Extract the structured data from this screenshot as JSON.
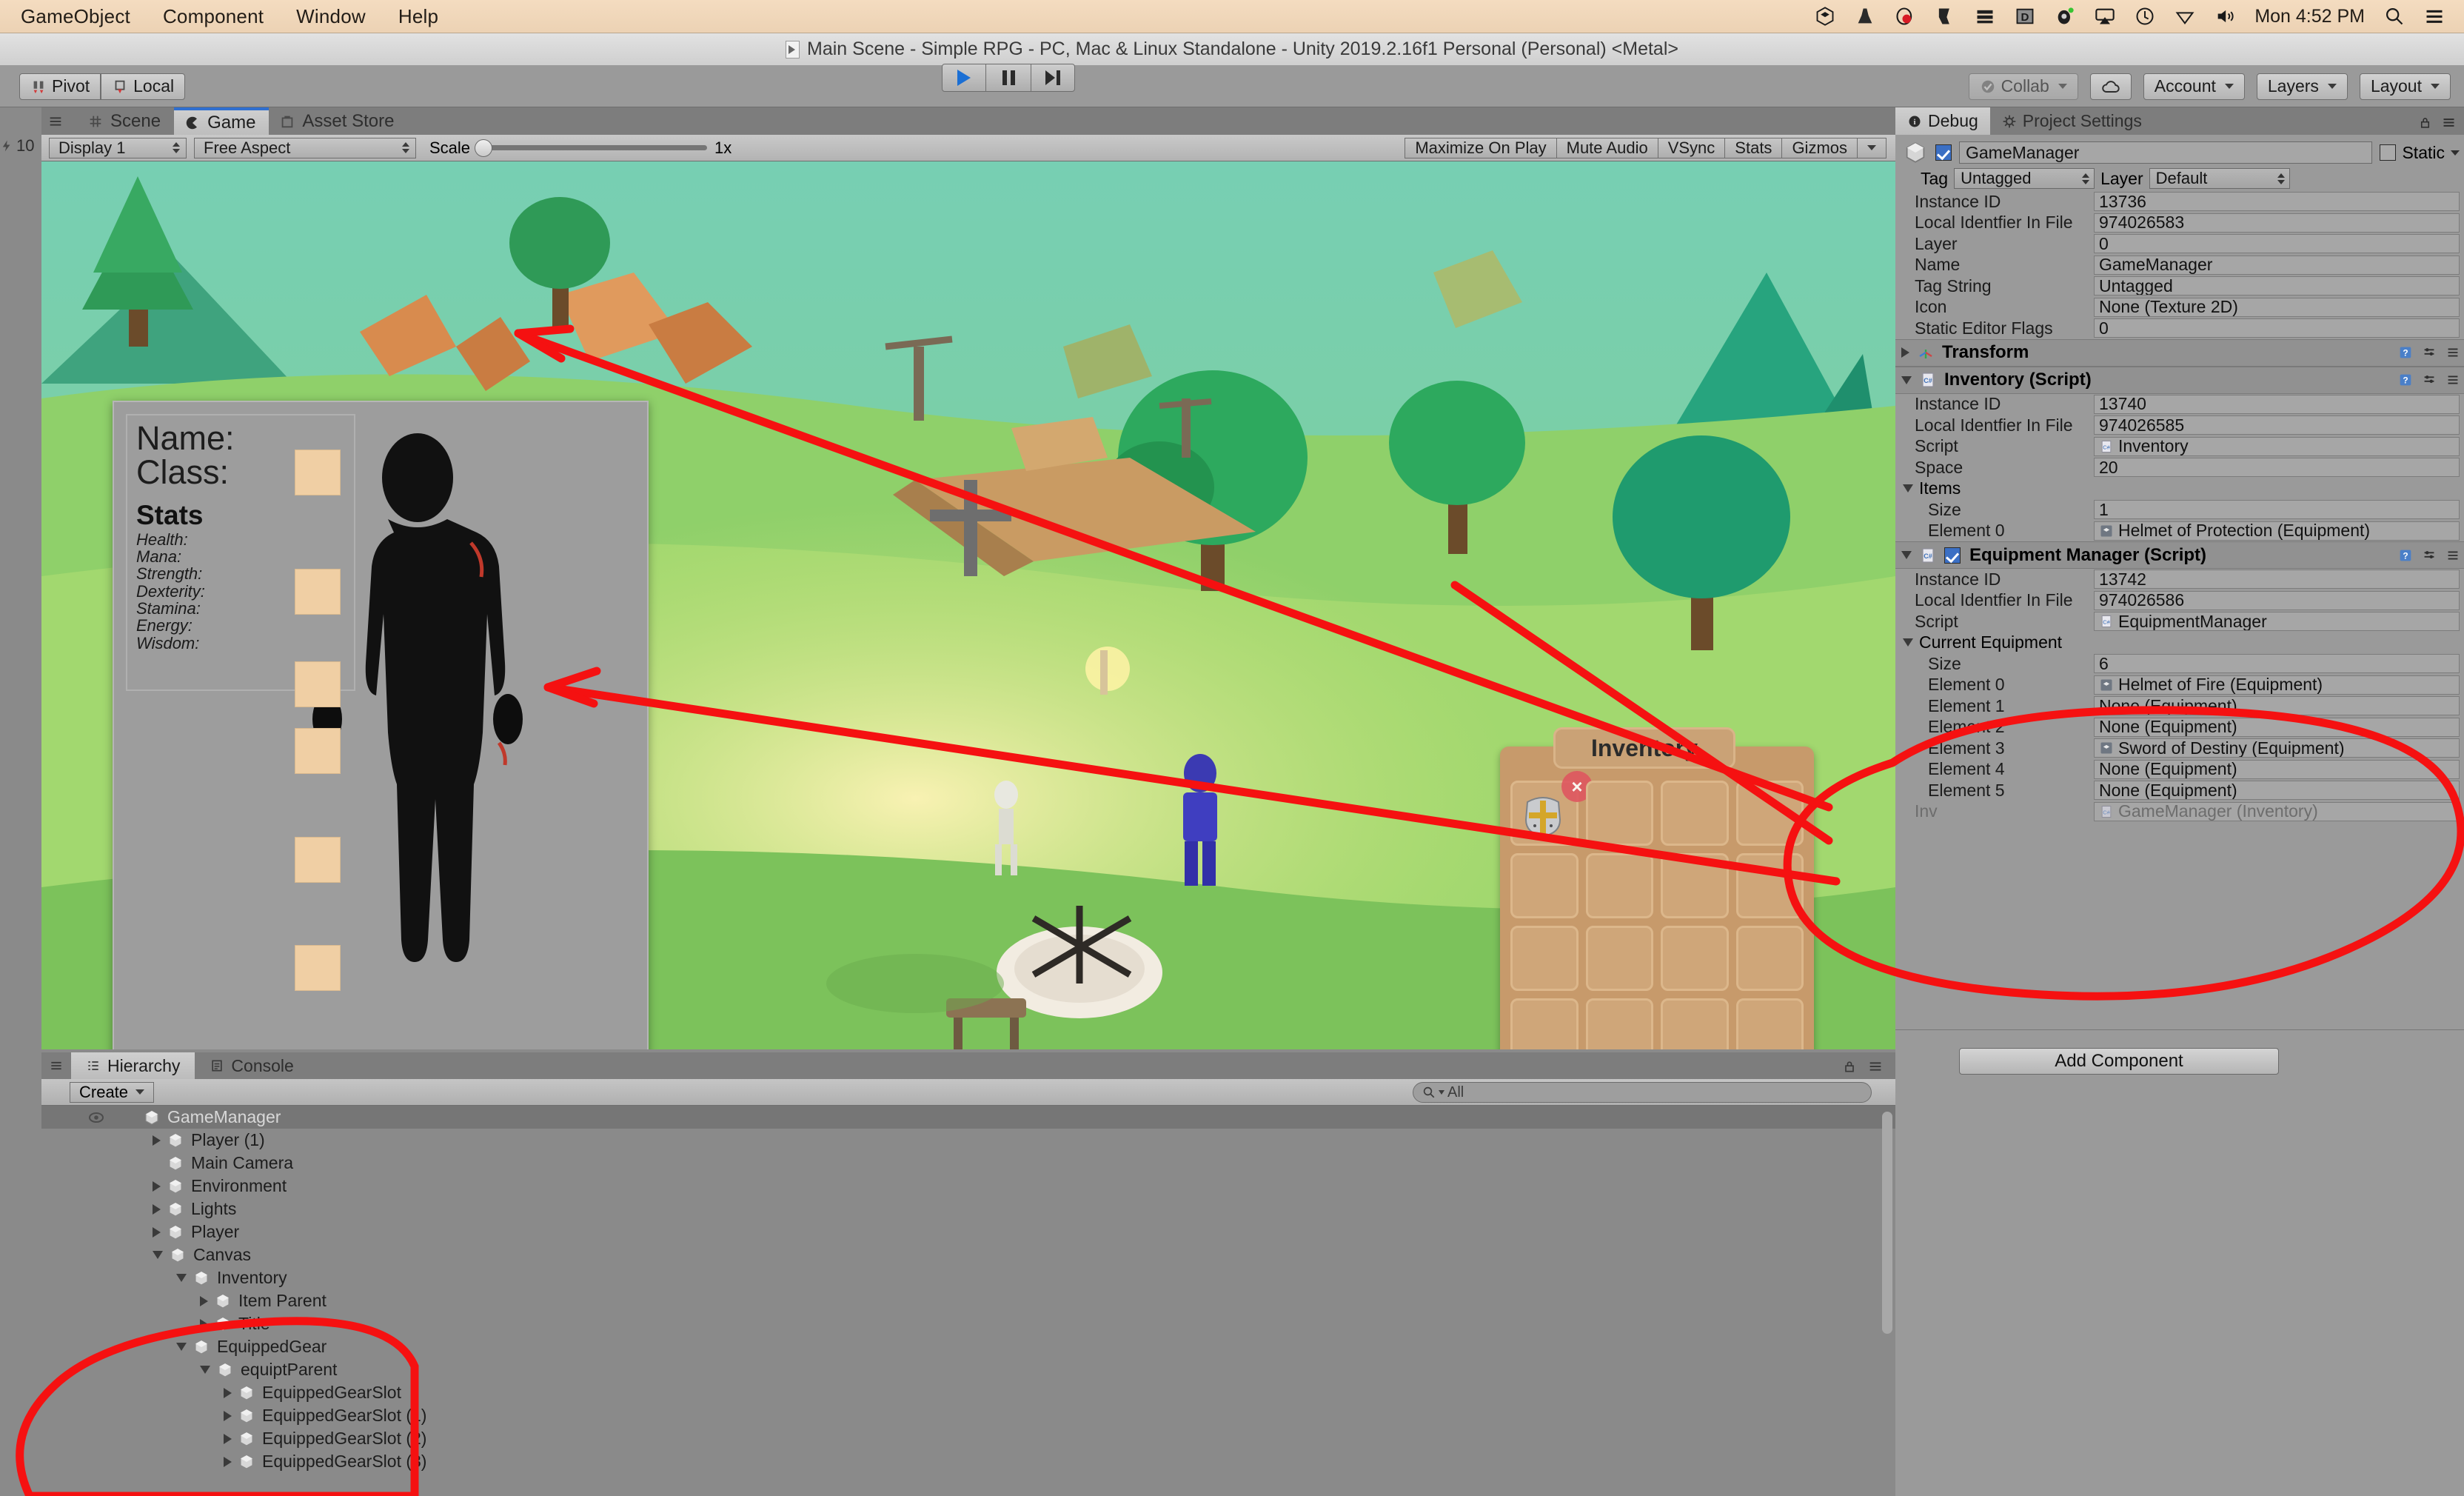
{
  "macbar": {
    "menus": [
      "GameObject",
      "Component",
      "Window",
      "Help"
    ],
    "tray_icons": [
      "unity-icon",
      "vlc-icon",
      "opera-icon",
      "anaconda-icon",
      "stack-icon",
      "dropbox-icon",
      "unity-hub-icon",
      "airplay-icon",
      "time-machine-icon",
      "wifi-icon",
      "volume-icon"
    ],
    "clock": "Mon 4:52 PM",
    "search_icon": "search-icon",
    "control_center_icon": "control-center-icon"
  },
  "titlebar": {
    "text": "Main Scene - Simple RPG - PC, Mac & Linux Standalone - Unity 2019.2.16f1 Personal (Personal) <Metal>",
    "doc_icon": "unity-document-icon"
  },
  "toolbar": {
    "pivot_label": "Pivot",
    "local_label": "Local",
    "pivot_icon": "pivot-icon",
    "local_icon": "local-icon",
    "play_icon": "play-icon",
    "pause_icon": "pause-icon",
    "step_icon": "step-icon",
    "collab_label": "Collab",
    "collab_icon": "collab-check-icon",
    "cloud_icon": "cloud-icon",
    "account_label": "Account",
    "layers_label": "Layers",
    "layout_label": "Layout"
  },
  "game_panel": {
    "tabs": [
      {
        "label": "Scene",
        "icon": "scene-grid-icon",
        "active": false
      },
      {
        "label": "Game",
        "icon": "game-pacman-icon",
        "active": true
      },
      {
        "label": "Asset Store",
        "icon": "asset-store-icon",
        "active": false
      }
    ],
    "stats_counter": "10",
    "display": "Display 1",
    "aspect": "Free Aspect",
    "scale_label": "Scale",
    "scale_value": "1x",
    "right_buttons": [
      "Maximize On Play",
      "Mute Audio",
      "VSync",
      "Stats",
      "Gizmos"
    ],
    "gizmos_caret": "chevron-down-icon"
  },
  "character_panel": {
    "name_label": "Name:",
    "class_label": "Class:",
    "stats_heading": "Stats",
    "stats": [
      "Health:",
      "Mana:",
      "Strength:",
      "Dexterity:",
      "Stamina:",
      "Energy:",
      "Wisdom:"
    ]
  },
  "inventory_panel": {
    "title": "Inventory",
    "delete_badge": "×",
    "item_icon": "knight-helmet-icon",
    "rows": 5,
    "cols": 4
  },
  "hierarchy": {
    "tabs": [
      {
        "label": "Hierarchy",
        "icon": "hierarchy-list-icon",
        "active": true
      },
      {
        "label": "Console",
        "icon": "console-icon",
        "active": false
      }
    ],
    "create_label": "Create",
    "create_caret": "chevron-down-icon",
    "search_placeholder": "All",
    "search_icon": "search-icon",
    "lock_icon": "lock-icon",
    "menu_icon": "panel-menu-icon",
    "items": [
      {
        "label": "GameManager",
        "depth": 0,
        "arrow": "none",
        "selected": true,
        "eye": true
      },
      {
        "label": "Player (1)",
        "depth": 1,
        "arrow": "closed",
        "selected": false
      },
      {
        "label": "Main Camera",
        "depth": 1,
        "arrow": "none",
        "selected": false
      },
      {
        "label": "Environment",
        "depth": 1,
        "arrow": "closed",
        "selected": false
      },
      {
        "label": "Lights",
        "depth": 1,
        "arrow": "closed",
        "selected": false
      },
      {
        "label": "Player",
        "depth": 1,
        "arrow": "closed",
        "selected": false
      },
      {
        "label": "Canvas",
        "depth": 1,
        "arrow": "open",
        "selected": false
      },
      {
        "label": "Inventory",
        "depth": 2,
        "arrow": "open",
        "selected": false
      },
      {
        "label": "Item Parent",
        "depth": 3,
        "arrow": "closed",
        "selected": false
      },
      {
        "label": "Title",
        "depth": 3,
        "arrow": "closed",
        "selected": false
      },
      {
        "label": "EquippedGear",
        "depth": 2,
        "arrow": "open",
        "selected": false
      },
      {
        "label": "equiptParent",
        "depth": 3,
        "arrow": "open",
        "selected": false
      },
      {
        "label": "EquippedGearSlot",
        "depth": 4,
        "arrow": "closed",
        "selected": false
      },
      {
        "label": "EquippedGearSlot (1)",
        "depth": 4,
        "arrow": "closed",
        "selected": false
      },
      {
        "label": "EquippedGearSlot (2)",
        "depth": 4,
        "arrow": "closed",
        "selected": false
      },
      {
        "label": "EquippedGearSlot (3)",
        "depth": 4,
        "arrow": "closed",
        "selected": false
      }
    ]
  },
  "inspector": {
    "tabs": [
      {
        "label": "Debug",
        "icon": "info-icon",
        "active": true
      },
      {
        "label": "Project Settings",
        "icon": "gear-icon",
        "active": false
      }
    ],
    "lock_icon": "lock-icon",
    "menu_icon": "panel-menu-icon",
    "gameobject_name": "GameManager",
    "gameobject_enabled": true,
    "static_label": "Static",
    "static_checked": false,
    "static_caret": "chevron-down-icon",
    "tag_label": "Tag",
    "tag_value": "Untagged",
    "layer_label": "Layer",
    "layer_value": "Default",
    "gameobject_props": [
      {
        "label": "Instance ID",
        "value": "13736"
      },
      {
        "label": "Local Identfier In File",
        "value": "974026583"
      },
      {
        "label": "Layer",
        "value": "0"
      },
      {
        "label": "Name",
        "value": "GameManager"
      },
      {
        "label": "Tag String",
        "value": "Untagged"
      },
      {
        "label": "Icon",
        "value": "None (Texture 2D)"
      },
      {
        "label": "Static Editor Flags",
        "value": "0"
      }
    ],
    "transform": {
      "title": "Transform",
      "icon": "transform-axis-icon",
      "expanded": false,
      "help_icon": "help-book-icon",
      "preset_icon": "preset-sliders-icon",
      "menu_icon": "component-menu-icon"
    },
    "inventory_script": {
      "title": "Inventory (Script)",
      "icon": "csharp-script-icon",
      "expanded": true,
      "props": [
        {
          "label": "Instance ID",
          "value": "13740",
          "indent": 0
        },
        {
          "label": "Local Identfier In File",
          "value": "974026585",
          "indent": 0
        },
        {
          "label": "Script",
          "value": "Inventory",
          "indent": 0,
          "obj_icon": "csharp-script-icon"
        },
        {
          "label": "Space",
          "value": "20",
          "indent": 0
        }
      ],
      "items_group": "Items",
      "items": [
        {
          "label": "Size",
          "value": "1",
          "indent": 1
        },
        {
          "label": "Element 0",
          "value": "Helmet of Protection (Equipment)",
          "indent": 1,
          "obj_icon": "unity-asset-icon"
        }
      ]
    },
    "equipment_manager": {
      "title": "Equipment Manager (Script)",
      "icon": "csharp-script-icon",
      "enabled": true,
      "expanded": true,
      "props": [
        {
          "label": "Instance ID",
          "value": "13742",
          "indent": 0
        },
        {
          "label": "Local Identfier In File",
          "value": "974026586",
          "indent": 0
        },
        {
          "label": "Script",
          "value": "EquipmentManager",
          "indent": 0,
          "obj_icon": "csharp-script-icon"
        }
      ],
      "current_equipment_group": "Current Equipment",
      "elements": [
        {
          "label": "Size",
          "value": "6",
          "indent": 1
        },
        {
          "label": "Element 0",
          "value": "Helmet of Fire (Equipment)",
          "indent": 1,
          "obj_icon": "unity-asset-icon"
        },
        {
          "label": "Element 1",
          "value": "None (Equipment)",
          "indent": 1
        },
        {
          "label": "Element 2",
          "value": "None (Equipment)",
          "indent": 1
        },
        {
          "label": "Element 3",
          "value": "Sword of Destiny (Equipment)",
          "indent": 1,
          "obj_icon": "unity-asset-icon"
        },
        {
          "label": "Element 4",
          "value": "None (Equipment)",
          "indent": 1
        },
        {
          "label": "Element 5",
          "value": "None (Equipment)",
          "indent": 1
        }
      ],
      "inv_label": "Inv",
      "inv_value": "GameManager (Inventory)",
      "inv_icon": "csharp-script-icon"
    },
    "add_component_label": "Add Component"
  },
  "annotation": {
    "color": "#f51111",
    "description": "red hand-drawn arrows and ellipses linking inspector equipment elements to avatar gear slots and the hierarchy EquippedGear group"
  }
}
